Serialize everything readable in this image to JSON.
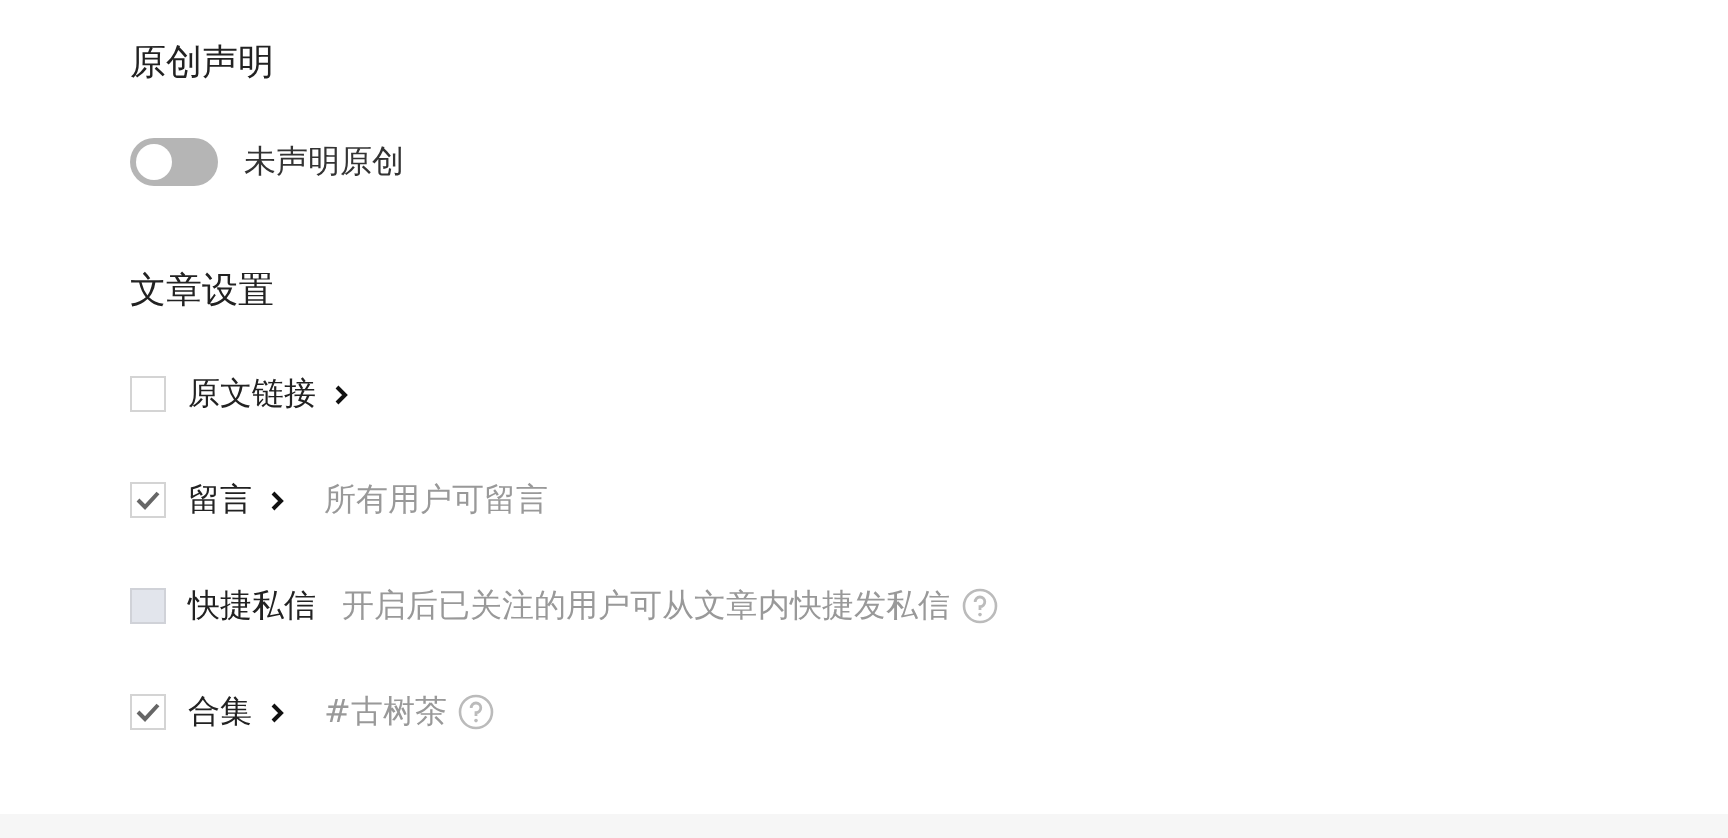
{
  "original_section": {
    "title": "原创声明",
    "toggle": {
      "on": false,
      "label": "未声明原创"
    }
  },
  "article_settings": {
    "title": "文章设置",
    "rows": [
      {
        "label": "原文链接",
        "checked": false,
        "disabled": false,
        "chevron": true,
        "help": false
      },
      {
        "label": "留言",
        "checked": true,
        "disabled": false,
        "chevron": true,
        "note": "所有用户可留言",
        "help": false
      },
      {
        "label": "快捷私信",
        "checked": false,
        "disabled": true,
        "chevron": false,
        "note": "开启后已关注的用户可从文章内快捷发私信",
        "help": true
      },
      {
        "label": "合集",
        "checked": true,
        "disabled": false,
        "chevron": true,
        "note": "#古树茶",
        "help": true
      }
    ]
  }
}
